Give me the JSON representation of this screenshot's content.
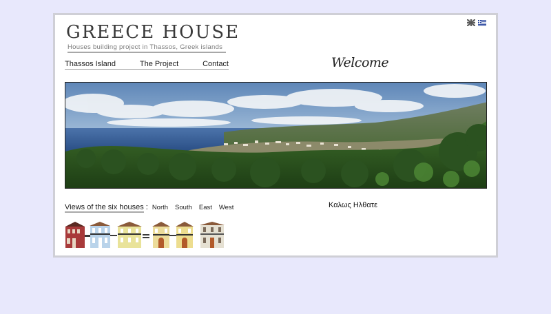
{
  "brand": {
    "title": "GREECE HOUSE",
    "subtitle": "Houses building project in Thassos, Greek islands"
  },
  "language_flags": [
    "english-flag-icon",
    "greek-flag-icon"
  ],
  "nav": {
    "items": [
      "Thassos Island",
      "The Project",
      "Contact"
    ]
  },
  "welcome": {
    "en": "Welcome",
    "gr": "Καλως Ηλθατε"
  },
  "views": {
    "label": "Views of the six houses",
    "separator": ":",
    "directions": [
      "North",
      "South",
      "East",
      "West"
    ]
  },
  "houses": [
    {
      "name": "house-1",
      "facade": "#a83a3a"
    },
    {
      "name": "house-2",
      "facade": "#b9d3ea"
    },
    {
      "name": "house-3",
      "facade": "#e9e39a"
    },
    {
      "name": "house-4",
      "facade": "#ecdc9a"
    },
    {
      "name": "house-5",
      "facade": "#eddd8f"
    },
    {
      "name": "house-6",
      "facade": "#e5e0d2"
    }
  ],
  "colors": {
    "page_background": "#e8e8fc",
    "frame": "#cfcfd6",
    "content_background": "#ffffff",
    "sea": "#2f5c9e",
    "forest": "#2e5a22"
  }
}
